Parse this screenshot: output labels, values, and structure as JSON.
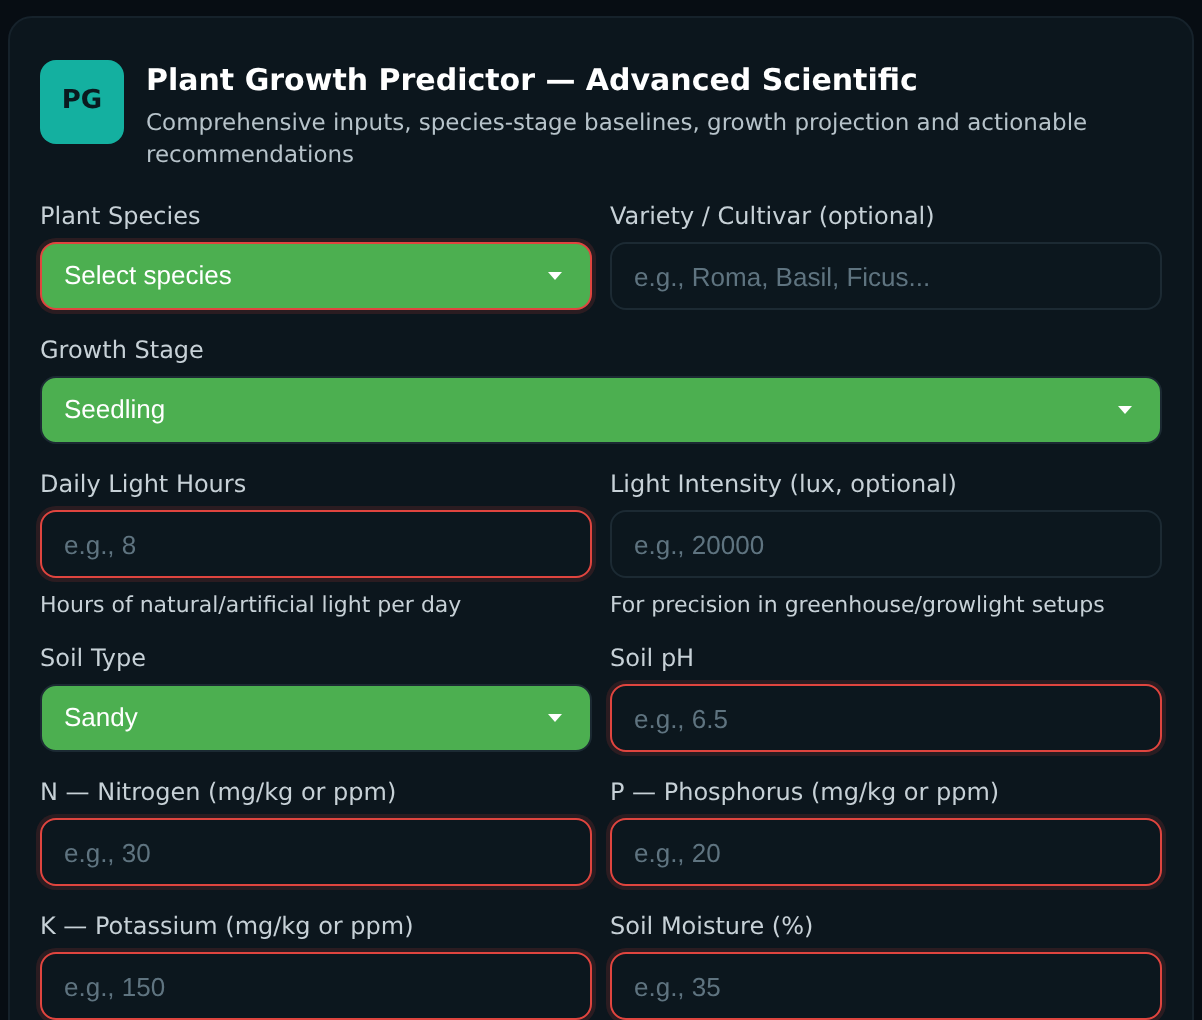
{
  "header": {
    "logo": "PG",
    "title": "Plant Growth Predictor — Advanced Scientific",
    "subtitle": "Comprehensive inputs, species-stage baselines, growth projection and actionable recommendations"
  },
  "rows": [
    {
      "fields": [
        {
          "kind": "select",
          "label": "Plant Species",
          "value": "Select species",
          "invalid": true
        },
        {
          "kind": "input",
          "label": "Variety / Cultivar (optional)",
          "placeholder": "e.g., Roma, Basil, Ficus...",
          "invalid": false
        }
      ]
    },
    {
      "fields": [
        {
          "kind": "select",
          "label": "Growth Stage",
          "value": "Seedling",
          "invalid": false
        }
      ]
    },
    {
      "fields": [
        {
          "kind": "input",
          "label": "Daily Light Hours",
          "placeholder": "e.g., 8",
          "invalid": true,
          "hint": "Hours of natural/artificial light per day"
        },
        {
          "kind": "input",
          "label": "Light Intensity (lux, optional)",
          "placeholder": "e.g., 20000",
          "invalid": false,
          "hint": "For precision in greenhouse/growlight setups"
        }
      ]
    },
    {
      "fields": [
        {
          "kind": "select",
          "label": "Soil Type",
          "value": "Sandy",
          "invalid": false
        },
        {
          "kind": "input",
          "label": "Soil pH",
          "placeholder": "e.g., 6.5",
          "invalid": true
        }
      ]
    },
    {
      "fields": [
        {
          "kind": "input",
          "label": "N — Nitrogen (mg/kg or ppm)",
          "placeholder": "e.g., 30",
          "invalid": true
        },
        {
          "kind": "input",
          "label": "P — Phosphorus (mg/kg or ppm)",
          "placeholder": "e.g., 20",
          "invalid": true
        }
      ]
    },
    {
      "fields": [
        {
          "kind": "input",
          "label": "K — Potassium (mg/kg or ppm)",
          "placeholder": "e.g., 150",
          "invalid": true
        },
        {
          "kind": "input",
          "label": "Soil Moisture (%)",
          "placeholder": "e.g., 35",
          "invalid": true
        }
      ]
    }
  ]
}
